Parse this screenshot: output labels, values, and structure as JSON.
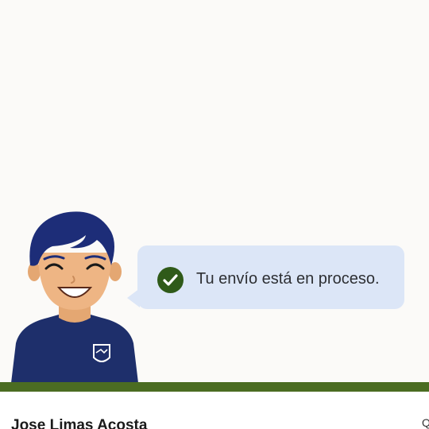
{
  "message": {
    "text": "Tu envío está en proceso.",
    "status_icon": "check-circle-icon",
    "bubble_color": "#dce6f7",
    "check_color": "#2f5a19"
  },
  "agent": {
    "avatar_icon": "agent-avatar-icon",
    "shirt_logo_icon": "handshake-shield-icon",
    "shirt_color": "#1e2f6b",
    "hair_color": "#1d2d78"
  },
  "footer": {
    "accent_color": "#4b6c22",
    "user_name": "Jose Limas Acosta",
    "right_glyph": "Q"
  }
}
